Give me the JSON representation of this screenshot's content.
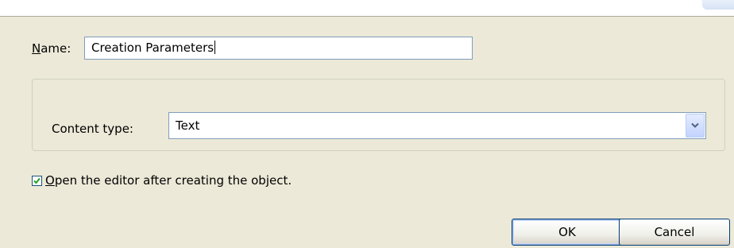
{
  "dialog": {
    "name_label_access": "N",
    "name_label_rest": "ame:",
    "name_value": "Creation Parameters",
    "content_type_label": "Content type:",
    "content_type_value": "Text",
    "open_editor_access": "O",
    "open_editor_rest": "pen the editor after creating the object.",
    "open_editor_checked": true,
    "ok_label": "OK",
    "cancel_label": "Cancel"
  },
  "icons": {
    "dropdown": "chevron-down-icon",
    "check": "checkmark-icon"
  },
  "colors": {
    "dialog_background": "#ece9d8",
    "input_border": "#7f9db9",
    "checkmark": "#21a121"
  }
}
